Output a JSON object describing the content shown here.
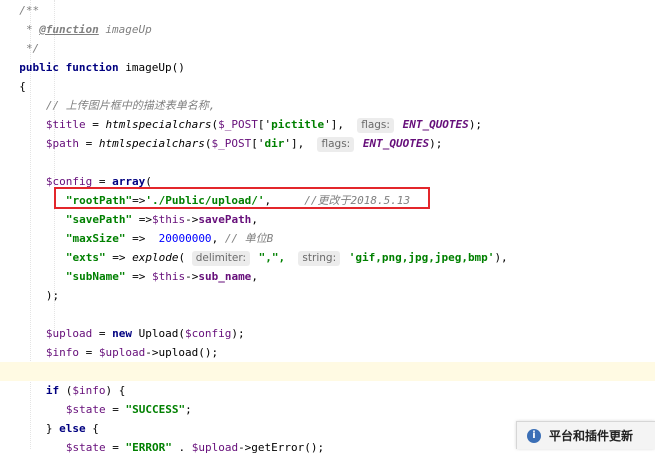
{
  "editor": {
    "lines": [
      {
        "indent": 2,
        "tokens": [
          {
            "t": "/**",
            "c": "cmt"
          }
        ]
      },
      {
        "indent": 3,
        "tokens": [
          {
            "t": "* ",
            "c": "cmt"
          },
          {
            "t": "@function",
            "c": "doctag"
          },
          {
            "t": " imageUp",
            "c": "cmt"
          }
        ]
      },
      {
        "indent": 3,
        "tokens": [
          {
            "t": "*/",
            "c": "cmt"
          }
        ]
      },
      {
        "indent": 2,
        "tokens": [
          {
            "t": "public function ",
            "c": "kw"
          },
          {
            "t": "imageUp()",
            "c": ""
          }
        ]
      },
      {
        "indent": 2,
        "tokens": [
          {
            "t": "{",
            "c": ""
          }
        ]
      },
      {
        "indent": 6,
        "tokens": [
          {
            "t": "// 上传图片框中的描述表单名称,",
            "c": "cmt"
          }
        ]
      },
      {
        "indent": 6,
        "tokens": [
          {
            "t": "$title",
            "c": "var"
          },
          {
            "t": " = ",
            "c": ""
          },
          {
            "t": "htmlspecialchars",
            "c": "fn"
          },
          {
            "t": "(",
            "c": ""
          },
          {
            "t": "$_POST",
            "c": "var"
          },
          {
            "t": "['",
            "c": ""
          },
          {
            "t": "pictitle",
            "c": "str"
          },
          {
            "t": "'],  ",
            "c": ""
          },
          {
            "t": "flags:",
            "c": "hint"
          },
          {
            "t": " ENT_QUOTES",
            "c": "const"
          },
          {
            "t": ");",
            "c": ""
          }
        ]
      },
      {
        "indent": 6,
        "tokens": [
          {
            "t": "$path",
            "c": "var"
          },
          {
            "t": " = ",
            "c": ""
          },
          {
            "t": "htmlspecialchars",
            "c": "fn"
          },
          {
            "t": "(",
            "c": ""
          },
          {
            "t": "$_POST",
            "c": "var"
          },
          {
            "t": "['",
            "c": ""
          },
          {
            "t": "dir",
            "c": "str"
          },
          {
            "t": "'],  ",
            "c": ""
          },
          {
            "t": "flags:",
            "c": "hint"
          },
          {
            "t": " ENT_QUOTES",
            "c": "const"
          },
          {
            "t": ");",
            "c": ""
          }
        ]
      },
      {
        "indent": 0,
        "tokens": []
      },
      {
        "indent": 6,
        "tokens": [
          {
            "t": "$config",
            "c": "var"
          },
          {
            "t": " = ",
            "c": ""
          },
          {
            "t": "array",
            "c": "kw"
          },
          {
            "t": "(",
            "c": ""
          }
        ]
      },
      {
        "indent": 9,
        "tokens": [
          {
            "t": "\"rootPath\"",
            "c": "key"
          },
          {
            "t": "=>",
            "c": ""
          },
          {
            "t": "'./Public/upload/'",
            "c": "str"
          },
          {
            "t": ",     ",
            "c": ""
          },
          {
            "t": "//更改于2018.5.13",
            "c": "cmt"
          }
        ]
      },
      {
        "indent": 9,
        "tokens": [
          {
            "t": "\"savePath\"",
            "c": "key"
          },
          {
            "t": " =>",
            "c": ""
          },
          {
            "t": "$this",
            "c": "var"
          },
          {
            "t": "->",
            "c": ""
          },
          {
            "t": "savePath",
            "c": "prop"
          },
          {
            "t": ",",
            "c": ""
          }
        ]
      },
      {
        "indent": 9,
        "tokens": [
          {
            "t": "\"maxSize\"",
            "c": "key"
          },
          {
            "t": " =>  ",
            "c": ""
          },
          {
            "t": "20000000",
            "c": "num"
          },
          {
            "t": ", ",
            "c": ""
          },
          {
            "t": "// 单位B",
            "c": "cmt"
          }
        ]
      },
      {
        "indent": 9,
        "tokens": [
          {
            "t": "\"exts\"",
            "c": "key"
          },
          {
            "t": " => ",
            "c": ""
          },
          {
            "t": "explode",
            "c": "fn"
          },
          {
            "t": "( ",
            "c": ""
          },
          {
            "t": "delimiter:",
            "c": "hint"
          },
          {
            "t": " \",\",  ",
            "c": "str"
          },
          {
            "t": "string:",
            "c": "hint"
          },
          {
            "t": " 'gif,png,jpg,jpeg,bmp'",
            "c": "str"
          },
          {
            "t": "),",
            "c": ""
          }
        ]
      },
      {
        "indent": 9,
        "tokens": [
          {
            "t": "\"subName\"",
            "c": "key"
          },
          {
            "t": " => ",
            "c": ""
          },
          {
            "t": "$this",
            "c": "var"
          },
          {
            "t": "->",
            "c": ""
          },
          {
            "t": "sub_name",
            "c": "prop"
          },
          {
            "t": ",",
            "c": ""
          }
        ]
      },
      {
        "indent": 6,
        "tokens": [
          {
            "t": ");",
            "c": ""
          }
        ]
      },
      {
        "indent": 0,
        "tokens": []
      },
      {
        "indent": 6,
        "tokens": [
          {
            "t": "$upload",
            "c": "var"
          },
          {
            "t": " = ",
            "c": ""
          },
          {
            "t": "new ",
            "c": "kw"
          },
          {
            "t": "Upload(",
            "c": ""
          },
          {
            "t": "$config",
            "c": "var"
          },
          {
            "t": ");",
            "c": ""
          }
        ]
      },
      {
        "indent": 6,
        "tokens": [
          {
            "t": "$info",
            "c": "var"
          },
          {
            "t": " = ",
            "c": ""
          },
          {
            "t": "$upload",
            "c": "var"
          },
          {
            "t": "->upload();",
            "c": ""
          }
        ]
      },
      {
        "indent": 0,
        "tokens": [],
        "highlight": true
      },
      {
        "indent": 6,
        "tokens": [
          {
            "t": "if ",
            "c": "kw"
          },
          {
            "t": "(",
            "c": ""
          },
          {
            "t": "$info",
            "c": "var"
          },
          {
            "t": ") {",
            "c": ""
          }
        ]
      },
      {
        "indent": 9,
        "tokens": [
          {
            "t": "$state",
            "c": "var"
          },
          {
            "t": " = ",
            "c": ""
          },
          {
            "t": "\"SUCCESS\"",
            "c": "str"
          },
          {
            "t": ";",
            "c": ""
          }
        ]
      },
      {
        "indent": 6,
        "tokens": [
          {
            "t": "} ",
            "c": ""
          },
          {
            "t": "else ",
            "c": "kw"
          },
          {
            "t": "{",
            "c": ""
          }
        ]
      },
      {
        "indent": 9,
        "tokens": [
          {
            "t": "$state",
            "c": "var"
          },
          {
            "t": " = ",
            "c": ""
          },
          {
            "t": "\"ERROR\"",
            "c": "str"
          },
          {
            "t": " . ",
            "c": ""
          },
          {
            "t": "$upload",
            "c": "var"
          },
          {
            "t": "->getError();",
            "c": ""
          }
        ]
      }
    ]
  },
  "notification": {
    "icon": "info-icon",
    "text": "平台和插件更新"
  }
}
